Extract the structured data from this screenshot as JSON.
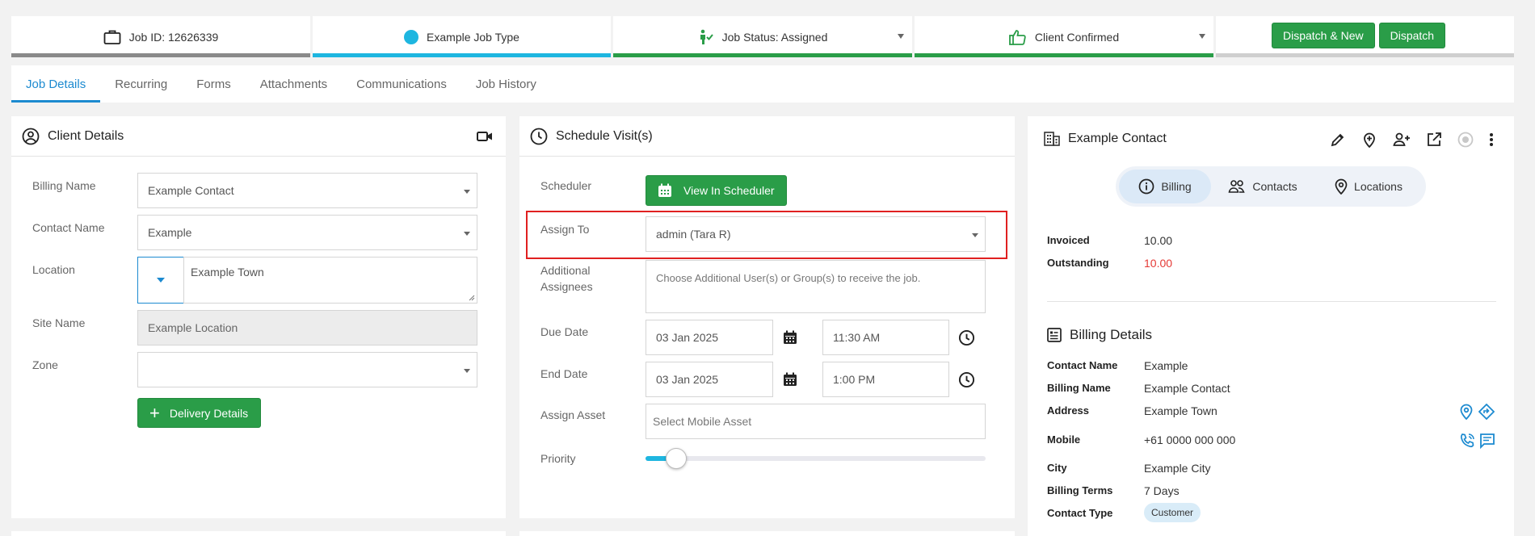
{
  "topbar": {
    "job_id": "Job ID: 12626339",
    "job_type": "Example Job Type",
    "job_status": "Job Status: Assigned",
    "client_confirmed": "Client Confirmed",
    "dispatch_new_label": "Dispatch & New",
    "dispatch_label": "Dispatch",
    "colors": {
      "job_id_bar": "#8a8a8a",
      "job_type_bar": "#1eb6e0",
      "status_bar": "#2a9d48",
      "confirmed_bar": "#2a9d48",
      "dispatch_bar": "#cfcfcf",
      "accent_green": "#2a9d48"
    }
  },
  "tabs": [
    "Job Details",
    "Recurring",
    "Forms",
    "Attachments",
    "Communications",
    "Job History"
  ],
  "client_details": {
    "title": "Client Details",
    "billing_name_label": "Billing Name",
    "billing_name_value": "Example Contact",
    "contact_name_label": "Contact Name",
    "contact_name_value": "Example",
    "location_label": "Location",
    "location_value": "Example Town",
    "site_name_label": "Site Name",
    "site_name_value": "Example Location",
    "zone_label": "Zone",
    "zone_value": "",
    "delivery_button": "Delivery Details"
  },
  "schedule": {
    "title": "Schedule Visit(s)",
    "scheduler_label": "Scheduler",
    "view_scheduler_button": "View In Scheduler",
    "assign_to_label": "Assign To",
    "assign_to_value": "admin (Tara R)",
    "additional_label_1": "Additional",
    "additional_label_2": "Assignees",
    "additional_placeholder": "Choose Additional User(s) or Group(s) to receive the job.",
    "due_date_label": "Due Date",
    "due_date_value": "03 Jan 2025",
    "due_time_value": "11:30 AM",
    "end_date_label": "End Date",
    "end_date_value": "03 Jan 2025",
    "end_time_value": "1:00 PM",
    "assign_asset_label": "Assign Asset",
    "assign_asset_placeholder": "Select Mobile Asset",
    "priority_label": "Priority",
    "priority_level": 0.06,
    "highlight_color": "#e02020"
  },
  "contact": {
    "name": "Example Contact",
    "pill_tabs": [
      "Billing",
      "Contacts",
      "Locations"
    ],
    "invoiced_label": "Invoiced",
    "invoiced_value": "10.00",
    "outstanding_label": "Outstanding",
    "outstanding_value": "10.00",
    "outstanding_color": "#e53935",
    "billing_details_title": "Billing Details",
    "rows": {
      "contact_name_label": "Contact Name",
      "contact_name_value": "Example",
      "billing_name_label": "Billing Name",
      "billing_name_value": "Example Contact",
      "address_label": "Address",
      "address_value": "Example Town",
      "mobile_label": "Mobile",
      "mobile_value": "+61 0000 000 000",
      "city_label": "City",
      "city_value": "Example City",
      "billing_terms_label": "Billing Terms",
      "billing_terms_value": "7 Days",
      "contact_type_label": "Contact Type",
      "contact_type_value": "Customer"
    }
  }
}
